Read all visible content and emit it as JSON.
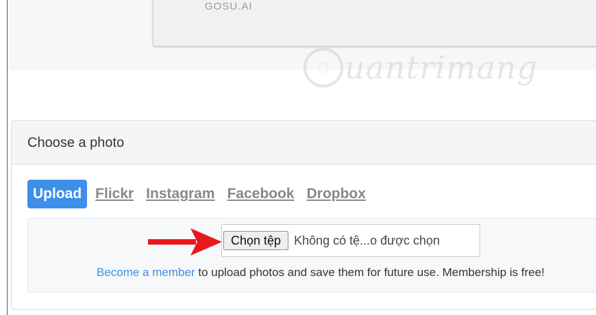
{
  "top_card": {
    "text": "GOSU.AI"
  },
  "watermark": {
    "text": "uantrimang"
  },
  "panel": {
    "title": "Choose a photo",
    "tabs": [
      {
        "label": "Upload",
        "active": true
      },
      {
        "label": "Flickr",
        "active": false
      },
      {
        "label": "Instagram",
        "active": false
      },
      {
        "label": "Facebook",
        "active": false
      },
      {
        "label": "Dropbox",
        "active": false
      }
    ],
    "file_input": {
      "button_label": "Chọn tệp",
      "status_text": "Không có tệ...o được chọn"
    },
    "membership": {
      "link_text": "Become a member",
      "rest_text": " to upload photos and save them for future use. Membership is free!"
    }
  },
  "colors": {
    "accent": "#3d8fe8",
    "arrow": "#e8181f"
  },
  "icons": {
    "watermark_logo": "lightbulb-icon",
    "pointer": "red-arrow-icon"
  }
}
